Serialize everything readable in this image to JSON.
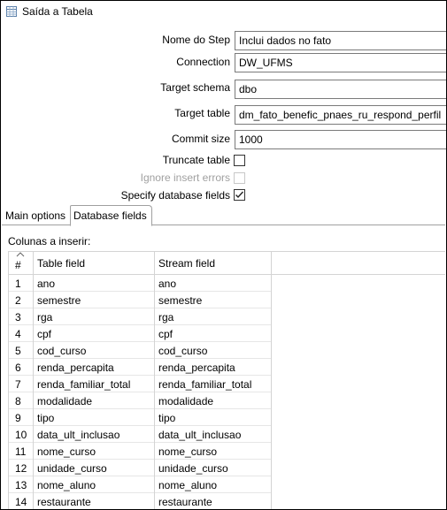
{
  "window": {
    "title": "Saída a Tabela",
    "icon": "table-output-icon"
  },
  "form": {
    "step_name": {
      "label": "Nome do Step",
      "value": "Inclui dados no fato"
    },
    "connection": {
      "label": "Connection",
      "value": "DW_UFMS"
    },
    "target_schema": {
      "label": "Target schema",
      "value": "dbo"
    },
    "target_table": {
      "label": "Target table",
      "value": "dm_fato_benefic_pnaes_ru_respond_perfil"
    },
    "commit_size": {
      "label": "Commit size",
      "value": "1000"
    },
    "truncate_table": {
      "label": "Truncate table",
      "checked": false
    },
    "ignore_insert_errors": {
      "label": "Ignore insert errors",
      "checked": false,
      "disabled": true
    },
    "specify_database_fields": {
      "label": "Specify database fields",
      "checked": true
    }
  },
  "tabs": [
    {
      "label": "Main options",
      "active": false
    },
    {
      "label": "Database fields",
      "active": true
    }
  ],
  "database_fields": {
    "section_label": "Colunas a inserir:",
    "columns": {
      "num": "#",
      "table_field": "Table field",
      "stream_field": "Stream field"
    },
    "rows": [
      {
        "num": "1",
        "table_field": "ano",
        "stream_field": "ano"
      },
      {
        "num": "2",
        "table_field": "semestre",
        "stream_field": "semestre"
      },
      {
        "num": "3",
        "table_field": "rga",
        "stream_field": "rga"
      },
      {
        "num": "4",
        "table_field": "cpf",
        "stream_field": "cpf"
      },
      {
        "num": "5",
        "table_field": "cod_curso",
        "stream_field": "cod_curso"
      },
      {
        "num": "6",
        "table_field": "renda_percapita",
        "stream_field": "renda_percapita"
      },
      {
        "num": "7",
        "table_field": "renda_familiar_total",
        "stream_field": "renda_familiar_total"
      },
      {
        "num": "8",
        "table_field": "modalidade",
        "stream_field": "modalidade"
      },
      {
        "num": "9",
        "table_field": "tipo",
        "stream_field": "tipo"
      },
      {
        "num": "10",
        "table_field": "data_ult_inclusao",
        "stream_field": "data_ult_inclusao"
      },
      {
        "num": "11",
        "table_field": "nome_curso",
        "stream_field": "nome_curso"
      },
      {
        "num": "12",
        "table_field": "unidade_curso",
        "stream_field": "unidade_curso"
      },
      {
        "num": "13",
        "table_field": "nome_aluno",
        "stream_field": "nome_aluno"
      },
      {
        "num": "14",
        "table_field": "restaurante",
        "stream_field": "restaurante"
      }
    ]
  }
}
